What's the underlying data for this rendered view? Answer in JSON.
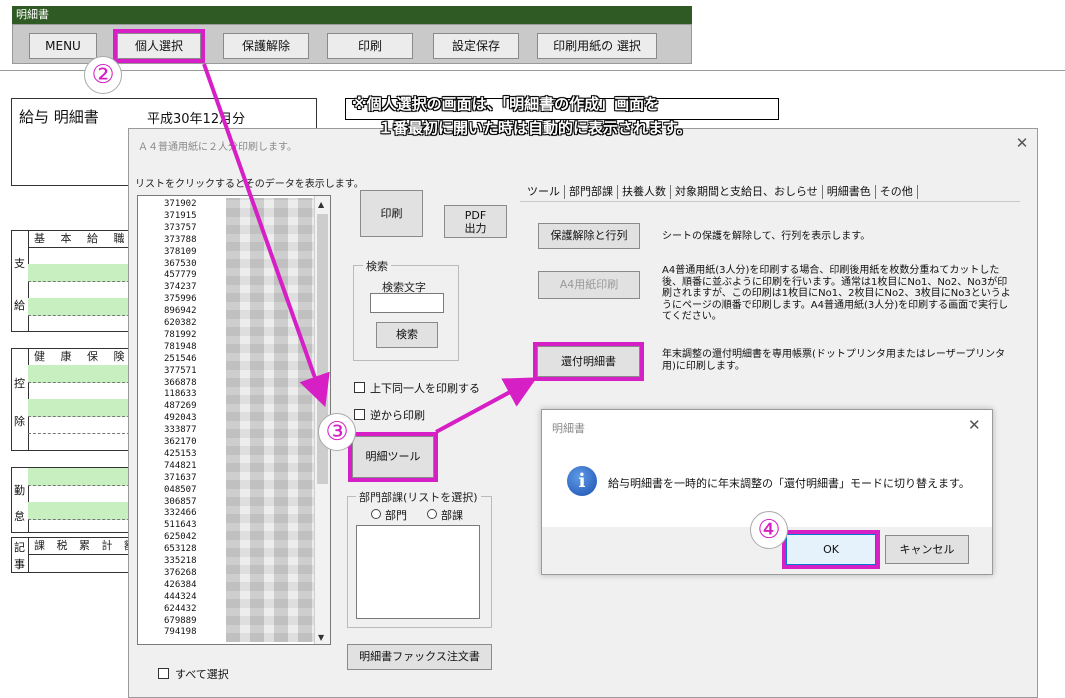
{
  "window": {
    "title": "明細書"
  },
  "toolbar": {
    "buttons": [
      "MENU",
      "個人選択",
      "保護解除",
      "印刷",
      "設定保存",
      "印刷用紙の 選択"
    ]
  },
  "sheet": {
    "title": "給与 明細書",
    "date": "平成30年12月分",
    "sections": [
      {
        "side": [
          "支",
          "給"
        ],
        "header": "基 本 給 職"
      },
      {
        "side": [
          "控",
          "除"
        ],
        "header": "健 康 保 険 介"
      },
      {
        "side": [
          "勤",
          "怠"
        ],
        "header": ""
      },
      {
        "side": [
          "記",
          "事"
        ],
        "header": "課 税 累 計 額 税"
      }
    ]
  },
  "annotation": {
    "note_line1": "※個人選択の画面は、「明細書の作成」画面を",
    "note_line2": "１番最初に開いた時は自動的に表示されます。",
    "step2": "②",
    "step3": "③",
    "step4": "④",
    "highlight_color": "#d61fc4"
  },
  "dialog": {
    "title": "Ａ４普通用紙に２人分印刷します。",
    "list_caption": "リストをクリックするとそのデータを表示します。",
    "list_ids": [
      "371902",
      "371915",
      "373757",
      "373788",
      "378109",
      "367530",
      "457779",
      "374237",
      "375996",
      "896942",
      "620382",
      "781992",
      "781948",
      "251546",
      "377571",
      "366878",
      "118633",
      "487269",
      "492043",
      "333877",
      "362170",
      "425153",
      "744821",
      "371637",
      "048507",
      "306857",
      "332466",
      "511643",
      "625042",
      "653128",
      "335218",
      "376268",
      "426384",
      "444324",
      "624432",
      "679889",
      "794198"
    ],
    "print_button": "印刷",
    "pdf_button": "PDF\n出力",
    "search_group": "検索",
    "search_label": "検索文字",
    "search_value": "",
    "search_button": "検索",
    "checkbox_same_person": "上下同一人を印刷する",
    "checkbox_reverse": "逆から印刷",
    "meisai_tool_button": "明細ツール",
    "dept_group": "部門部課(リストを選択)",
    "radio_dept": "部門",
    "radio_section": "部課",
    "fax_button": "明細書ファックス注文書",
    "select_all": "すべて選択",
    "tabs": [
      "ツール",
      "部門部課",
      "扶養人数",
      "対象期間と支給日、おしらせ",
      "明細書色",
      "その他"
    ],
    "tools": [
      {
        "button": "保護解除と行列",
        "desc": "シートの保護を解除して、行列を表示します。"
      },
      {
        "button": "A4用紙印刷",
        "desc": "A4普通用紙(3人分)を印刷する場合、印刷後用紙を枚数分重ねてカットした後、順番に並ぶように印刷を行います。通常は1枚目にNo1、No2、No3が印刷されますが、この印刷は1枚目にNo1、2枚目にNo2、3枚目にNo3というようにページの順番で印刷します。A4普通用紙(3人分)を印刷する画面で実行してください。"
      },
      {
        "button": "還付明細書",
        "desc": "年末調整の還付明細書を専用帳票(ドットプリンタ用またはレーザープリンタ用)に印刷します。"
      }
    ]
  },
  "subdialog": {
    "title": "明細書",
    "message": "給与明細書を一時的に年末調整の「還付明細書」モードに切り替えます。",
    "ok": "OK",
    "cancel": "キャンセル"
  }
}
